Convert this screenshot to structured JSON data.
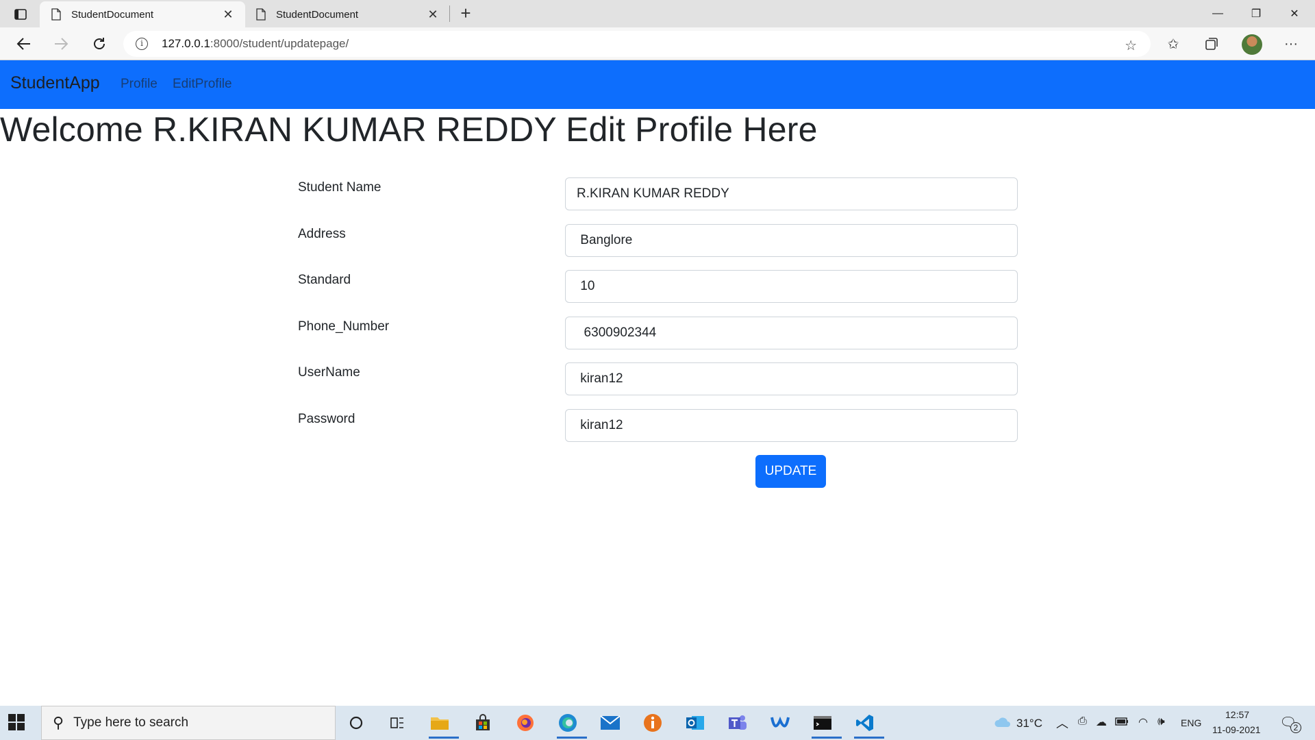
{
  "browser": {
    "tabs": [
      {
        "title": "StudentDocument",
        "active": true
      },
      {
        "title": "StudentDocument",
        "active": false
      }
    ],
    "url_host": "127.0.0.1",
    "url_path": ":8000/student/updatepage/",
    "window_controls": {
      "minimize": "—",
      "restore": "❐",
      "close": "✕"
    }
  },
  "navbar": {
    "brand": "StudentApp",
    "links": [
      "Profile",
      "EditProfile"
    ],
    "color": "#0d6efd"
  },
  "page": {
    "heading": "Welcome R.KIRAN KUMAR REDDY Edit Profile Here"
  },
  "form": {
    "fields": [
      {
        "label": "Student Name",
        "value": "R.KIRAN KUMAR REDDY"
      },
      {
        "label": "Address",
        "value": " Banglore"
      },
      {
        "label": "Standard",
        "value": " 10"
      },
      {
        "label": "Phone_Number",
        "value": "  6300902344"
      },
      {
        "label": "UserName",
        "value": " kiran12"
      },
      {
        "label": "Password",
        "value": " kiran12"
      }
    ],
    "submit_label": "UPDATE"
  },
  "taskbar": {
    "search_placeholder": "Type here to search",
    "weather": "31°C",
    "language": "ENG",
    "time": "12:57",
    "date": "11-09-2021",
    "notifications": "2"
  }
}
